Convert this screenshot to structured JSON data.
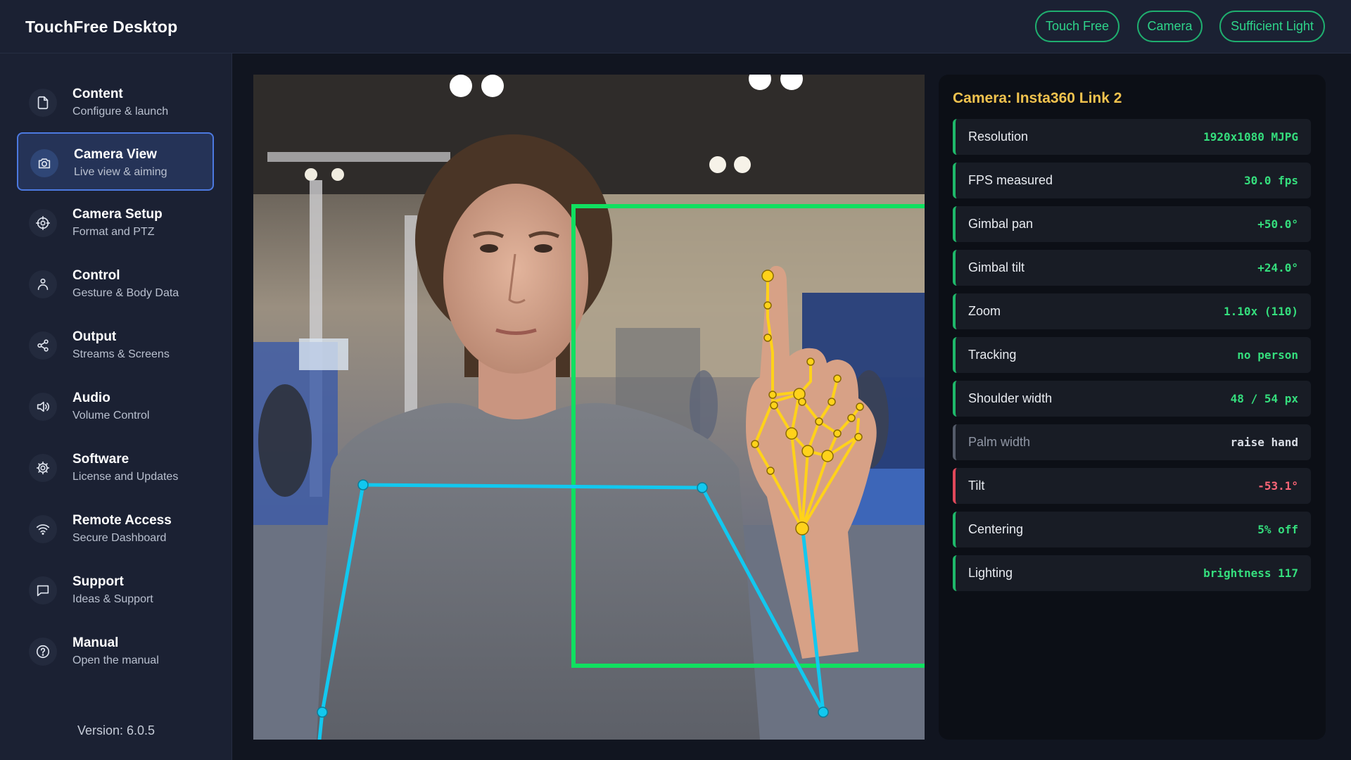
{
  "header": {
    "app_title": "TouchFree Desktop",
    "status_pills": [
      "Touch Free",
      "Camera",
      "Sufficient Light"
    ],
    "accent_color": "#2ed48a"
  },
  "sidebar": {
    "active_item": "Camera View",
    "items": [
      {
        "title": "Content",
        "subtitle": "Configure & launch",
        "icon": "file-icon"
      },
      {
        "title": "Camera View",
        "subtitle": "Live view & aiming",
        "icon": "camera-icon"
      },
      {
        "title": "Camera Setup",
        "subtitle": "Format and PTZ",
        "icon": "crosshair-icon"
      },
      {
        "title": "Control",
        "subtitle": "Gesture & Body Data",
        "icon": "person-icon"
      },
      {
        "title": "Output",
        "subtitle": "Streams & Screens",
        "icon": "share-icon"
      },
      {
        "title": "Audio",
        "subtitle": "Volume Control",
        "icon": "speaker-icon"
      },
      {
        "title": "Software",
        "subtitle": "License and Updates",
        "icon": "gear-icon"
      },
      {
        "title": "Remote Access",
        "subtitle": "Secure Dashboard",
        "icon": "wifi-icon"
      },
      {
        "title": "Support",
        "subtitle": "Ideas & Support",
        "icon": "chat-icon"
      },
      {
        "title": "Manual",
        "subtitle": "Open the manual",
        "icon": "help-icon"
      }
    ],
    "version": "Version: 6.0.5"
  },
  "camera_feed": {
    "overlay_colors": {
      "body": "#12c8ef",
      "hand": "#ffd21a",
      "frame": "#10e060"
    }
  },
  "info_panel": {
    "title": "Camera: Insta360 Link 2",
    "metrics": [
      {
        "label": "Resolution",
        "value": "1920x1080 MJPG",
        "status": "ok"
      },
      {
        "label": "FPS measured",
        "value": "30.0 fps",
        "status": "ok"
      },
      {
        "label": "Gimbal pan",
        "value": "+50.0°",
        "status": "ok"
      },
      {
        "label": "Gimbal tilt",
        "value": "+24.0°",
        "status": "ok"
      },
      {
        "label": "Zoom",
        "value": "1.10x (110)",
        "status": "ok"
      },
      {
        "label": "Tracking",
        "value": "no person",
        "status": "ok"
      },
      {
        "label": "Shoulder width",
        "value": "48 / 54 px",
        "status": "ok"
      },
      {
        "label": "Palm width",
        "value": "raise hand",
        "status": "neutral"
      },
      {
        "label": "Tilt",
        "value": "-53.1°",
        "status": "bad"
      },
      {
        "label": "Centering",
        "value": "5% off",
        "status": "ok"
      },
      {
        "label": "Lighting",
        "value": "brightness 117",
        "status": "ok"
      }
    ]
  }
}
